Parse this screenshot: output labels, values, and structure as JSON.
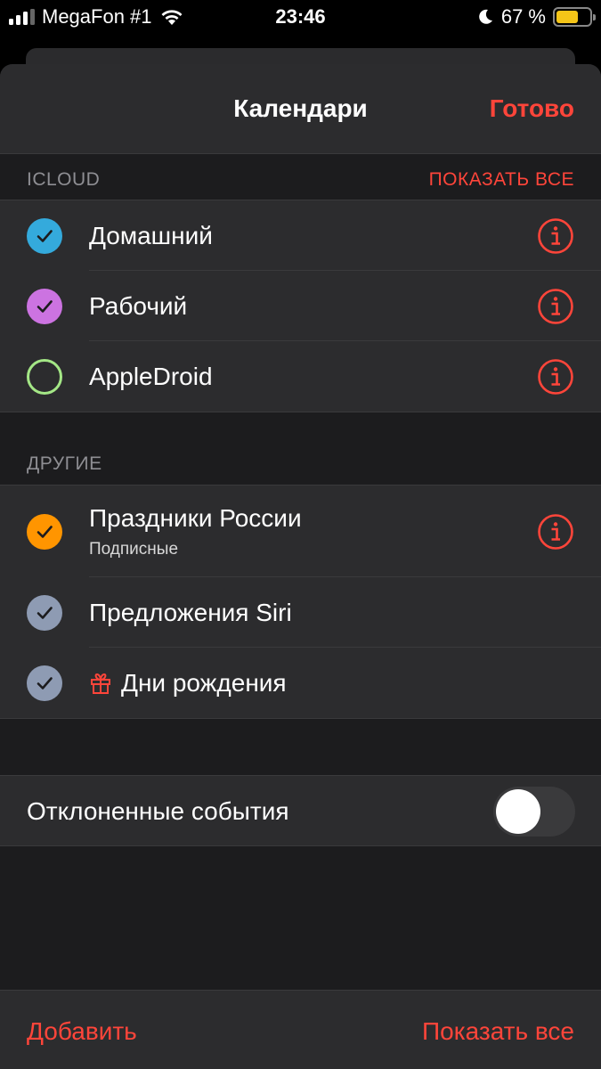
{
  "status_bar": {
    "carrier": "MegaFon #1",
    "time": "23:46",
    "battery_percent": "67 %",
    "battery_level": 0.67
  },
  "nav": {
    "title": "Календари",
    "done_label": "Готово"
  },
  "sections": {
    "icloud": {
      "title": "ICLOUD",
      "action": "ПОКАЗАТЬ ВСЕ",
      "items": [
        {
          "label": "Домашний",
          "color": "#34aadc",
          "checked": true
        },
        {
          "label": "Рабочий",
          "color": "#cc73e1",
          "checked": true
        },
        {
          "label": "AppleDroid",
          "color": "#a4e786",
          "checked": false
        }
      ]
    },
    "other": {
      "title": "ДРУГИЕ",
      "items": [
        {
          "label": "Праздники России",
          "subtitle": "Подписные",
          "color": "#ff9500",
          "checked": true
        },
        {
          "label": "Предложения Siri",
          "color": "#8e9bb3",
          "checked": true
        },
        {
          "label": "Дни рождения",
          "color": "#8e9bb3",
          "checked": true
        }
      ]
    }
  },
  "declined_events": {
    "label": "Отклоненные события",
    "enabled": false
  },
  "toolbar": {
    "add_label": "Добавить",
    "show_all_label": "Показать все"
  },
  "colors": {
    "accent": "#ff453a",
    "background": "#1c1c1e",
    "cell": "#2c2c2e",
    "secondary_text": "#8e8e93"
  }
}
